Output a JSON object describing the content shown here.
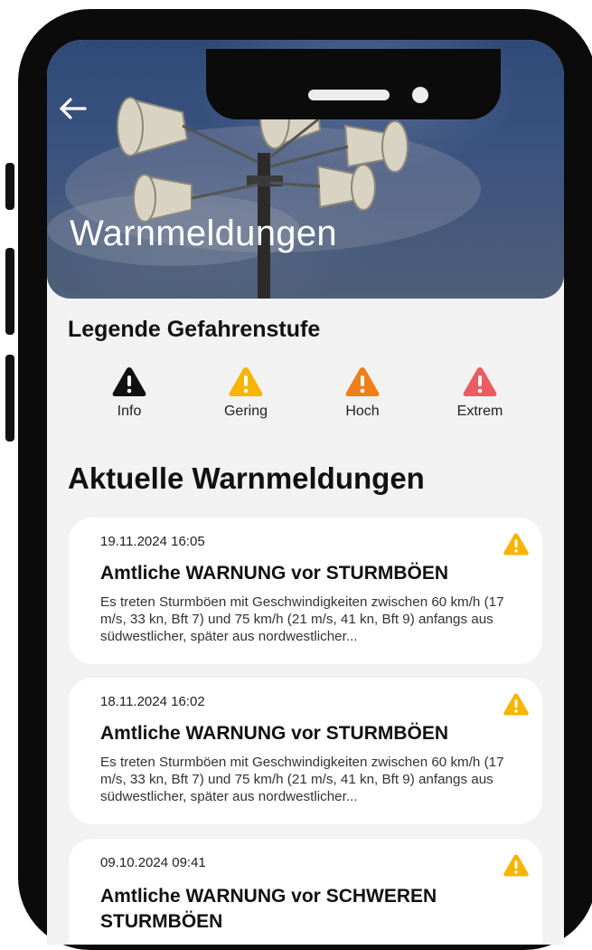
{
  "header": {
    "title": "Warnmeldungen"
  },
  "legend": {
    "title": "Legende Gefahrenstufe",
    "items": [
      {
        "label": "Info",
        "color": "#111111",
        "icon": "warning-icon"
      },
      {
        "label": "Gering",
        "color": "#f7b500",
        "icon": "warning-icon"
      },
      {
        "label": "Hoch",
        "color": "#f07f1a",
        "icon": "warning-icon"
      },
      {
        "label": "Extrem",
        "color": "#ee5a61",
        "icon": "warning-icon"
      }
    ]
  },
  "warnings": {
    "title": "Aktuelle Warnmeldungen",
    "items": [
      {
        "date": "19.11.2024 16:05",
        "title": "Amtliche WARNUNG vor STURMBÖEN",
        "text": "Es treten Sturmböen mit Geschwindigkeiten zwischen 60 km/h (17 m/s, 33 kn, Bft 7) und 75 km/h (21 m/s, 41 kn, Bft 9) anfangs aus südwestlicher, später aus nordwestlicher...",
        "level_color": "#f7b500"
      },
      {
        "date": "18.11.2024 16:02",
        "title": "Amtliche WARNUNG vor STURMBÖEN",
        "text": "Es treten Sturmböen mit Geschwindigkeiten zwischen 60 km/h (17 m/s, 33 kn, Bft 7) und 75 km/h (21 m/s, 41 kn, Bft 9) anfangs aus südwestlicher, später aus nordwestlicher...",
        "level_color": "#f7b500"
      },
      {
        "date": "09.10.2024 09:41",
        "title": "Amtliche WARNUNG vor SCHWEREN STURMBÖEN",
        "text": "",
        "level_color": "#f7b500"
      }
    ]
  }
}
